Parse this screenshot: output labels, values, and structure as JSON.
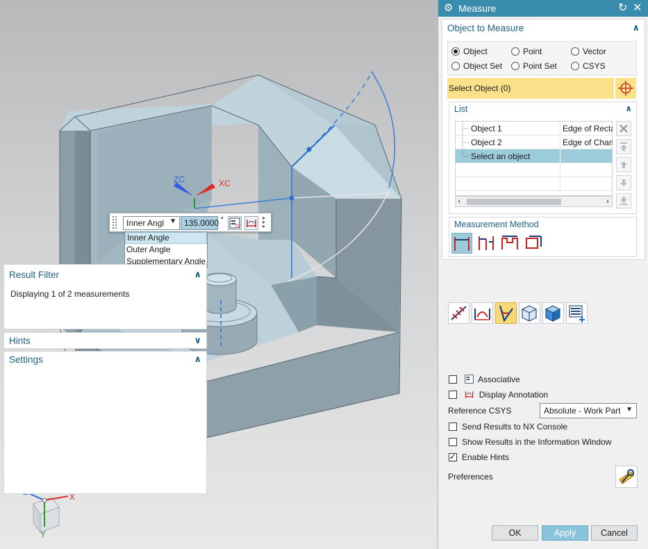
{
  "viewport": {
    "csys_labels": {
      "zc": "ZC",
      "xc": "XC"
    },
    "triad_labels": {
      "z": "Z",
      "x": "X",
      "y": "Y"
    },
    "float_toolbar": {
      "angle_type_value": "Inner Angl",
      "angle_value": "135.0000",
      "unit": "°",
      "options": [
        "Inner Angle",
        "Outer Angle",
        "Supplementary Angle"
      ],
      "selected_option": "Inner Angle"
    }
  },
  "dialog": {
    "title": "Measure",
    "object_to_measure": {
      "heading": "Object to Measure",
      "radios": [
        {
          "label": "Object",
          "checked": true
        },
        {
          "label": "Point",
          "checked": false
        },
        {
          "label": "Vector",
          "checked": false
        },
        {
          "label": "Object Set",
          "checked": false
        },
        {
          "label": "Point Set",
          "checked": false
        },
        {
          "label": "CSYS",
          "checked": false
        }
      ],
      "select_object_label": "Select Object (0)",
      "list": {
        "heading": "List",
        "rows": [
          {
            "name": "Object 1",
            "value": "Edge of Recta"
          },
          {
            "name": "Object 2",
            "value": "Edge of Chan"
          },
          {
            "name": "Select an object",
            "value": ""
          }
        ]
      },
      "measurement_method": {
        "heading": "Measurement Method"
      }
    },
    "result_filter": {
      "heading": "Result Filter",
      "displaying_text": "Displaying 1 of 2 measurements"
    },
    "hints": {
      "heading": "Hints"
    },
    "settings": {
      "heading": "Settings",
      "associative": {
        "label": "Associative",
        "checked": false
      },
      "display_annotation": {
        "label": "Display Annotation",
        "checked": false
      },
      "reference_csys_label": "Reference CSYS",
      "reference_csys_value": "Absolute - Work Part",
      "send_results": {
        "label": "Send Results to NX Console",
        "checked": false
      },
      "show_results": {
        "label": "Show Results in the Information Window",
        "checked": false
      },
      "enable_hints": {
        "label": "Enable Hints",
        "checked": true
      },
      "preferences_label": "Preferences"
    },
    "buttons": {
      "ok": "OK",
      "apply": "Apply",
      "cancel": "Cancel"
    }
  },
  "colors": {
    "title_bar": "#3a8cae",
    "section_heading": "#1d5f86",
    "selection_highlight": "#fbe28a",
    "list_selected": "#9ccbda",
    "apply_button": "#8ac3dd"
  }
}
